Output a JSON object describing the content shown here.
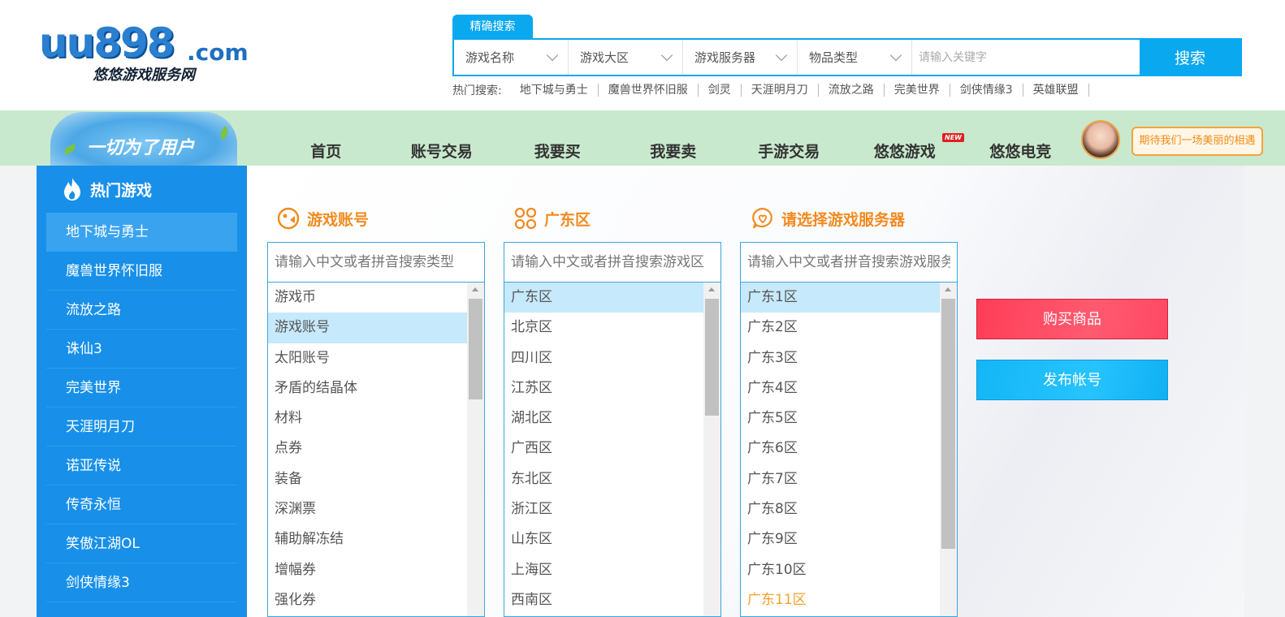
{
  "logo": {
    "brand": "uu898",
    "domain": ".com",
    "subtitle": "悠悠游戏服务网"
  },
  "search": {
    "tab_label": "精确搜索",
    "selects": [
      "游戏名称",
      "游戏大区",
      "游戏服务器",
      "物品类型"
    ],
    "keyword_placeholder": "请输入关键字",
    "button_label": "搜索",
    "hot_label": "热门搜索:",
    "hot_items": [
      "地下城与勇士",
      "魔兽世界怀旧服",
      "剑灵",
      "天涯明月刀",
      "流放之路",
      "完美世界",
      "剑侠情缘3",
      "英雄联盟"
    ]
  },
  "banner": {
    "slogan": "一切为了用户",
    "bubble_text": "期待我们一场美丽的相遇"
  },
  "nav": {
    "items": [
      "首页",
      "账号交易",
      "我要买",
      "我要卖",
      "手游交易",
      "悠悠游戏",
      "悠悠电竞"
    ],
    "new_badge": "NEW"
  },
  "sidebar": {
    "title": "热门游戏",
    "items": [
      "地下城与勇士",
      "魔兽世界怀旧服",
      "流放之路",
      "诛仙3",
      "完美世界",
      "天涯明月刀",
      "诺亚传说",
      "传奇永恒",
      "笑傲江湖OL",
      "剑侠情缘3"
    ],
    "active_index": 0
  },
  "columns": [
    {
      "title": "游戏账号",
      "placeholder": "请输入中文或者拼音搜索类型",
      "items": [
        "游戏币",
        "游戏账号",
        "太阳账号",
        "矛盾的结晶体",
        "材料",
        "点券",
        "装备",
        "深渊票",
        "辅助解冻结",
        "增幅券",
        "强化券"
      ],
      "selected_index": 1
    },
    {
      "title": "广东区",
      "placeholder": "请输入中文或者拼音搜索游戏区",
      "items": [
        "广东区",
        "北京区",
        "四川区",
        "江苏区",
        "湖北区",
        "广西区",
        "东北区",
        "浙江区",
        "山东区",
        "上海区",
        "西南区"
      ],
      "selected_index": 0
    },
    {
      "title": "请选择游戏服务器",
      "placeholder": "请输入中文或者拼音搜索游戏服务",
      "items": [
        "广东1区",
        "广东2区",
        "广东3区",
        "广东4区",
        "广东5区",
        "广东6区",
        "广东7区",
        "广东8区",
        "广东9区",
        "广东10区",
        "广东11区"
      ],
      "selected_index": 0,
      "highlight_index": 10
    }
  ],
  "actions": {
    "buy_label": "购买商品",
    "publish_label": "发布帐号"
  },
  "colors": {
    "primary": "#0aa8ee",
    "sidebar": "#1890e9",
    "accent_orange": "#f28a1e",
    "buy_red": "#ff4864",
    "publish_blue": "#14b6f5"
  }
}
